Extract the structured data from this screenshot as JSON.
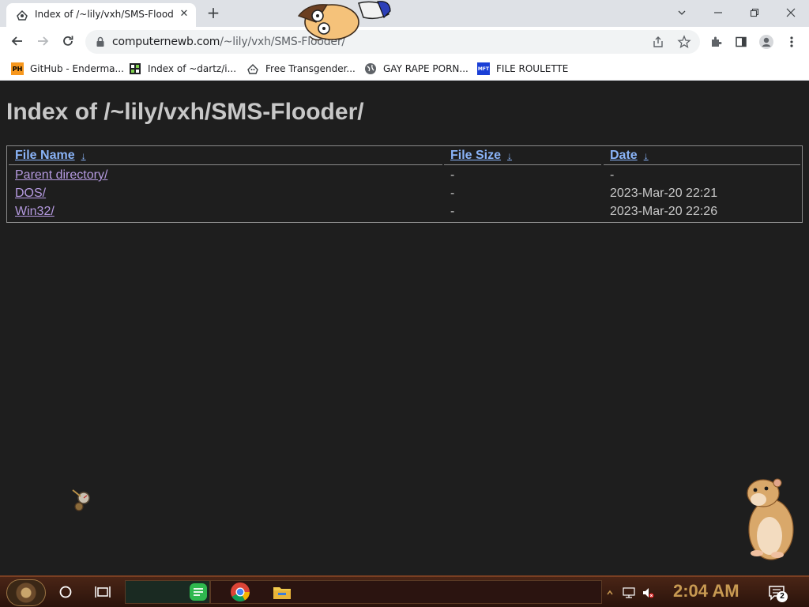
{
  "browser": {
    "tab_title": "Index of /~lily/vxh/SMS-Flooder/",
    "tab_close": "✕",
    "new_tab": "+",
    "url_host": "computernewb.com",
    "url_path": "/~lily/vxh/SMS-F",
    "url_tail": "looder/"
  },
  "bookmarks": [
    {
      "label": "GitHub - Enderma...",
      "icon": "PH",
      "icon_color": "#f7971d"
    },
    {
      "label": "Index of ~dartz/i...",
      "icon": "grid-icon"
    },
    {
      "label": "Free Transgender...",
      "icon": "face-icon"
    },
    {
      "label": "GAY RAPE PORN...",
      "icon": "globe-icon"
    },
    {
      "label": "FILE ROULETTE",
      "icon": "MFT",
      "icon_color": "#1a3fd6"
    }
  ],
  "page": {
    "title": "Index of /~lily/vxh/SMS-Flooder/",
    "headers": {
      "name": "File Name",
      "size": "File Size",
      "date": "Date",
      "sort_glyph": "↓"
    },
    "rows": [
      {
        "name": "Parent directory/",
        "size": "-",
        "date": "-"
      },
      {
        "name": "DOS/",
        "size": "-",
        "date": "2023-Mar-20 22:21"
      },
      {
        "name": "Win32/",
        "size": "-",
        "date": "2023-Mar-20 22:26"
      }
    ],
    "link_color": "#8ab4f8",
    "visited_color": "#b59ae0"
  },
  "taskbar": {
    "clock": "2:04 AM",
    "notification_count": "2",
    "accent": "#c89a52"
  }
}
